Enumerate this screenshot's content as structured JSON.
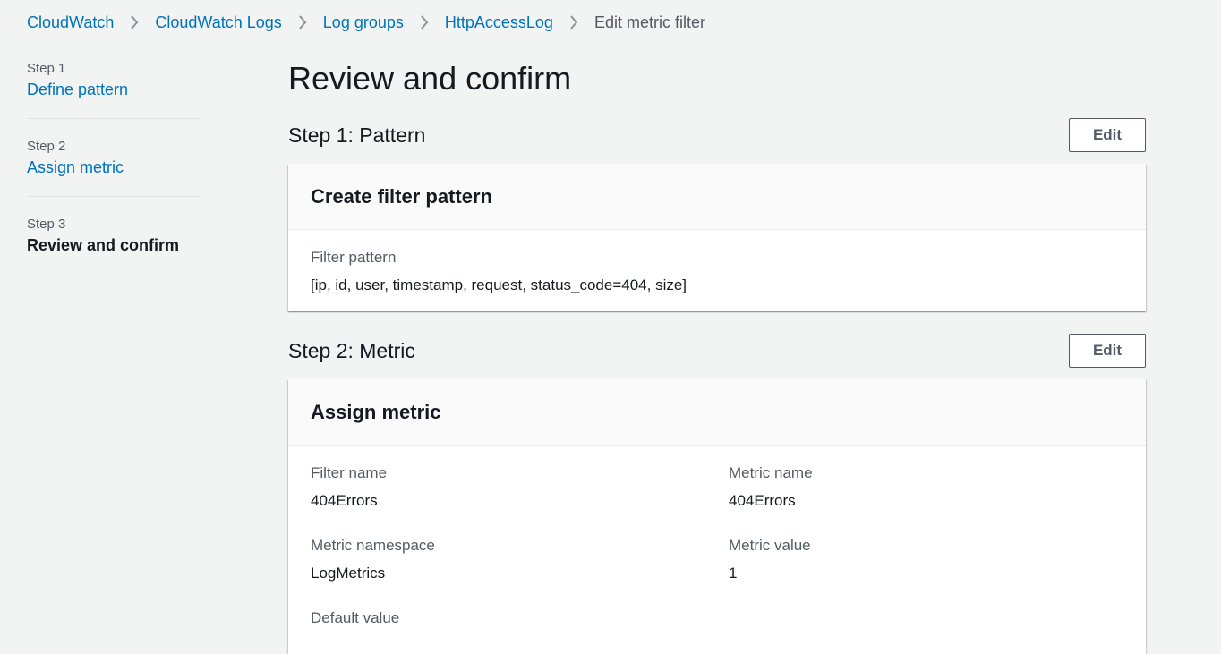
{
  "breadcrumb": {
    "items": [
      "CloudWatch",
      "CloudWatch Logs",
      "Log groups",
      "HttpAccessLog"
    ],
    "current": "Edit metric filter"
  },
  "steps": [
    {
      "label": "Step 1",
      "title": "Define pattern"
    },
    {
      "label": "Step 2",
      "title": "Assign metric"
    },
    {
      "label": "Step 3",
      "title": "Review and confirm"
    }
  ],
  "main": {
    "title": "Review and confirm",
    "edit_label": "Edit",
    "section1": {
      "heading": "Step 1: Pattern",
      "container_title": "Create filter pattern",
      "filter_pattern_label": "Filter pattern",
      "filter_pattern_value": "[ip, id, user, timestamp, request, status_code=404, size]"
    },
    "section2": {
      "heading": "Step 2: Metric",
      "container_title": "Assign metric",
      "filter_name_label": "Filter name",
      "filter_name_value": "404Errors",
      "metric_name_label": "Metric name",
      "metric_name_value": "404Errors",
      "metric_namespace_label": "Metric namespace",
      "metric_namespace_value": "LogMetrics",
      "metric_value_label": "Metric value",
      "metric_value_value": "1",
      "default_value_label": "Default value"
    }
  },
  "icons": {
    "separator": "chevron-right-icon"
  },
  "colors": {
    "link": "#0073bb",
    "text": "#16191f",
    "muted": "#545b64",
    "background": "#f2f3f3"
  }
}
